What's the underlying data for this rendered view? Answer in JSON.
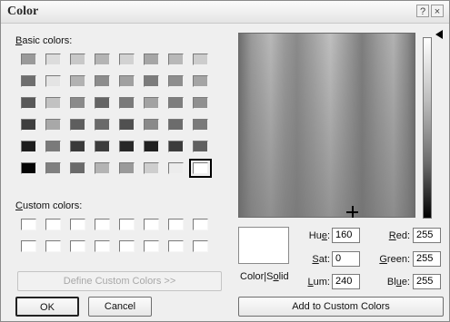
{
  "window": {
    "title": "Color",
    "help_icon": "?",
    "close_icon": "×"
  },
  "basic": {
    "label_pre": "",
    "label_u": "B",
    "label_post": "asic colors:",
    "swatches": [
      "#9a9a9a",
      "#dcdcdc",
      "#c8c8c8",
      "#b4b4b4",
      "#d2d2d2",
      "#a6a6a6",
      "#b8b8b8",
      "#cccccc",
      "#6e6e6e",
      "#e4e4e4",
      "#b2b2b2",
      "#8c8c8c",
      "#a0a0a0",
      "#7c7c7c",
      "#8e8e8e",
      "#a4a4a4",
      "#585858",
      "#c2c2c2",
      "#8a8a8a",
      "#646464",
      "#7a7a7a",
      "#a2a2a2",
      "#7e7e7e",
      "#909090",
      "#3e3e3e",
      "#a8a8a8",
      "#5e5e5e",
      "#6a6a6a",
      "#505050",
      "#8a8a8a",
      "#6c6c6c",
      "#7a7a7a",
      "#1e1e1e",
      "#7a7a7a",
      "#3a3a3a",
      "#3c3c3c",
      "#282828",
      "#202020",
      "#3c3c3c",
      "#606060",
      "#050505",
      "#808080",
      "#6a6a6a",
      "#b4b4b4",
      "#9a9a9a",
      "#cecece",
      "#ececec",
      "#ffffff"
    ],
    "selected_index": 47
  },
  "custom": {
    "label_pre": "",
    "label_u": "C",
    "label_post": "ustom colors:"
  },
  "buttons": {
    "define": "Define Custom Colors >>",
    "ok": "OK",
    "cancel": "Cancel",
    "add": "Add to Custom Colors"
  },
  "preview": {
    "label_pre": "Color|S",
    "label_u": "o",
    "label_post": "lid",
    "color": "#ffffff"
  },
  "fields": {
    "hue": {
      "pre": "Hu",
      "u": "e",
      "post": ":",
      "value": "160"
    },
    "sat": {
      "pre": "",
      "u": "S",
      "post": "at:",
      "value": "0"
    },
    "lum": {
      "pre": "",
      "u": "L",
      "post": "um:",
      "value": "240"
    },
    "red": {
      "pre": "",
      "u": "R",
      "post": "ed:",
      "value": "255"
    },
    "green": {
      "pre": "",
      "u": "G",
      "post": "reen:",
      "value": "255"
    },
    "blue": {
      "pre": "Bl",
      "u": "u",
      "post": "e:",
      "value": "255"
    }
  },
  "icons": {
    "crosshair": "crosshair-icon",
    "luminosity_arrow": "arrow-left-icon"
  }
}
